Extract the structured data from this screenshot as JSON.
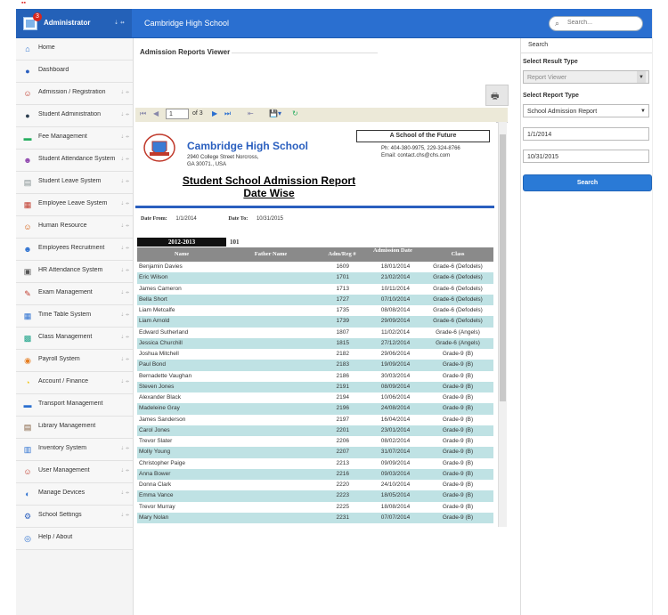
{
  "header": {
    "admin_label": "Administrator",
    "badge_count": "3",
    "arrows": "⇣ ⇸",
    "school_title": "Cambridge High School",
    "search_placeholder": "Search..."
  },
  "sidebar": {
    "items": [
      {
        "label": "Home",
        "icon": "home-icon",
        "glyph": "⌂",
        "color": "#2a6fd0",
        "arrow": ""
      },
      {
        "label": "Dashboard",
        "icon": "dashboard-icon",
        "glyph": "●",
        "color": "#2a5fbf",
        "arrow": ""
      },
      {
        "label": "Admission / Registration",
        "icon": "admission-icon",
        "glyph": "☺",
        "color": "#c0392b",
        "arrow": "⇣ ⇸"
      },
      {
        "label": "Student Administration",
        "icon": "student-admin-icon",
        "glyph": "●",
        "color": "#2c3e50",
        "arrow": "⇣ ⇸"
      },
      {
        "label": "Fee Management",
        "icon": "fee-icon",
        "glyph": "▬",
        "color": "#27ae60",
        "arrow": "⇣ ⇸"
      },
      {
        "label": "Student Attendance System",
        "icon": "attendance-icon",
        "glyph": "☻",
        "color": "#8e44ad",
        "arrow": "⇣ ⇸"
      },
      {
        "label": "Student Leave System",
        "icon": "leave-icon",
        "glyph": "▤",
        "color": "#7f8c8d",
        "arrow": "⇣ ⇸"
      },
      {
        "label": "Employee Leave System",
        "icon": "employee-leave-icon",
        "glyph": "▦",
        "color": "#c0392b",
        "arrow": "⇣ ⇸"
      },
      {
        "label": "Human Resource",
        "icon": "hr-icon",
        "glyph": "☺",
        "color": "#d35400",
        "arrow": "⇣ ⇸"
      },
      {
        "label": "Employees Recruitment",
        "icon": "recruitment-icon",
        "glyph": "☻",
        "color": "#2a6fd0",
        "arrow": "⇣ ⇸"
      },
      {
        "label": "HR Attendance System",
        "icon": "hr-attendance-icon",
        "glyph": "▣",
        "color": "#555555",
        "arrow": "⇣ ⇸"
      },
      {
        "label": "Exam Management",
        "icon": "exam-icon",
        "glyph": "✎",
        "color": "#c0392b",
        "arrow": "⇣ ⇸"
      },
      {
        "label": "Time Table System",
        "icon": "timetable-icon",
        "glyph": "▦",
        "color": "#2a6fd0",
        "arrow": "⇣ ⇸"
      },
      {
        "label": "Class Management",
        "icon": "class-icon",
        "glyph": "▩",
        "color": "#16a085",
        "arrow": "⇣ ⇸"
      },
      {
        "label": "Payroll System",
        "icon": "payroll-icon",
        "glyph": "◉",
        "color": "#e67e22",
        "arrow": "⇣ ⇸"
      },
      {
        "label": "Account / Finance",
        "icon": "finance-icon",
        "glyph": "◔",
        "color": "#f1c40f",
        "arrow": "⇣ ⇸"
      },
      {
        "label": "Transport Management",
        "icon": "transport-icon",
        "glyph": "▬",
        "color": "#2a6fd0",
        "arrow": ""
      },
      {
        "label": "Library Management",
        "icon": "library-icon",
        "glyph": "▤",
        "color": "#7f5a3a",
        "arrow": ""
      },
      {
        "label": "Inventory System",
        "icon": "inventory-icon",
        "glyph": "▥",
        "color": "#2a6fd0",
        "arrow": "⇣ ⇸"
      },
      {
        "label": "User Management",
        "icon": "user-icon",
        "glyph": "☺",
        "color": "#c0392b",
        "arrow": "⇣ ⇸"
      },
      {
        "label": "Manage Devices",
        "icon": "devices-icon",
        "glyph": "◐",
        "color": "#2a6fd0",
        "arrow": "⇣ ⇸"
      },
      {
        "label": "School Settings",
        "icon": "settings-icon",
        "glyph": "⚙",
        "color": "#2a5fbf",
        "arrow": "⇣ ⇸"
      },
      {
        "label": "Help / About",
        "icon": "help-icon",
        "glyph": "◎",
        "color": "#2a6fd0",
        "arrow": ""
      }
    ]
  },
  "main": {
    "viewer_title": "Admission Reports Viewer",
    "toolbar": {
      "page": "1",
      "of_label": "of 3"
    },
    "report": {
      "school_name": "Cambridge High School",
      "address": "2940 College Street Norcross, GA 30071., USA",
      "motto": "A School of the Future",
      "phone": "Ph: 404-380-9975, 229-324-8766",
      "email": "Email: contact.chs@chs.com",
      "title_line1": "Student School Admission Report",
      "title_line2": "Date Wise",
      "date_from_label": "Date From:",
      "date_from": "1/1/2014",
      "date_to_label": "Date To:",
      "date_to": "10/31/2015",
      "year": "2012-2013",
      "year_count": "101",
      "columns": [
        "Name",
        "Father Name",
        "Adm/Reg #",
        "Admission Date",
        "Class"
      ],
      "rows": [
        [
          "Benjamin Davies",
          "",
          "1609",
          "18/01/2014",
          "Grade-6 (Defodels)"
        ],
        [
          "Eric Wilson",
          "",
          "1701",
          "21/02/2014",
          "Grade-6 (Defodels)"
        ],
        [
          "James Cameron",
          "",
          "1713",
          "10/11/2014",
          "Grade-6 (Defodels)"
        ],
        [
          "Bella Short",
          "",
          "1727",
          "07/10/2014",
          "Grade-6 (Defodels)"
        ],
        [
          "Liam Metcalfe",
          "",
          "1735",
          "08/08/2014",
          "Grade-6 (Defodels)"
        ],
        [
          "Liam Arnold",
          "",
          "1739",
          "29/09/2014",
          "Grade-6 (Defodels)"
        ],
        [
          "Edward Sutherland",
          "",
          "1807",
          "11/02/2014",
          "Grade-6 (Angels)"
        ],
        [
          "Jessica Churchill",
          "",
          "1815",
          "27/12/2014",
          "Grade-6 (Angels)"
        ],
        [
          "Joshua Mitchell",
          "",
          "2182",
          "29/06/2014",
          "Grade-9 (B)"
        ],
        [
          "Paul Bond",
          "",
          "2183",
          "19/09/2014",
          "Grade-9 (B)"
        ],
        [
          "Bernadette Vaughan",
          "",
          "2186",
          "30/03/2014",
          "Grade-9 (B)"
        ],
        [
          "Steven Jones",
          "",
          "2191",
          "08/09/2014",
          "Grade-9 (B)"
        ],
        [
          "Alexander Black",
          "",
          "2194",
          "10/06/2014",
          "Grade-9 (B)"
        ],
        [
          "Madeleine Gray",
          "",
          "2196",
          "24/08/2014",
          "Grade-9 (B)"
        ],
        [
          "James Sanderson",
          "",
          "2197",
          "16/04/2014",
          "Grade-9 (B)"
        ],
        [
          "Carol Jones",
          "",
          "2201",
          "23/01/2014",
          "Grade-9 (B)"
        ],
        [
          "Trevor Slater",
          "",
          "2206",
          "08/02/2014",
          "Grade-9 (B)"
        ],
        [
          "Molly Young",
          "",
          "2207",
          "31/07/2014",
          "Grade-9 (B)"
        ],
        [
          "Christopher Paige",
          "",
          "2213",
          "09/09/2014",
          "Grade-9 (B)"
        ],
        [
          "Anna Bower",
          "",
          "2216",
          "09/03/2014",
          "Grade-9 (B)"
        ],
        [
          "Donna Clark",
          "",
          "2220",
          "24/10/2014",
          "Grade-9 (B)"
        ],
        [
          "Emma Vance",
          "",
          "2223",
          "18/05/2014",
          "Grade-9 (B)"
        ],
        [
          "Trevor Murray",
          "",
          "2225",
          "18/08/2014",
          "Grade-9 (B)"
        ],
        [
          "Mary Nolan",
          "",
          "2231",
          "07/07/2014",
          "Grade-9 (B)"
        ]
      ]
    }
  },
  "right_panel": {
    "title": "Search",
    "result_type_label": "Select Result Type",
    "result_type_value": "Report Viewer",
    "report_type_label": "Select Report Type",
    "report_type_value": "School Admission Report",
    "date_from": "1/1/2014",
    "date_to": "10/31/2015",
    "search_button": "Search"
  },
  "colors": {
    "header_bg": "#2a6fd0",
    "accent_blue": "#2a5fbf",
    "row_alt": "#bfe2e4",
    "table_header": "#8a8a8a",
    "search_button": "#2a7ad6"
  }
}
